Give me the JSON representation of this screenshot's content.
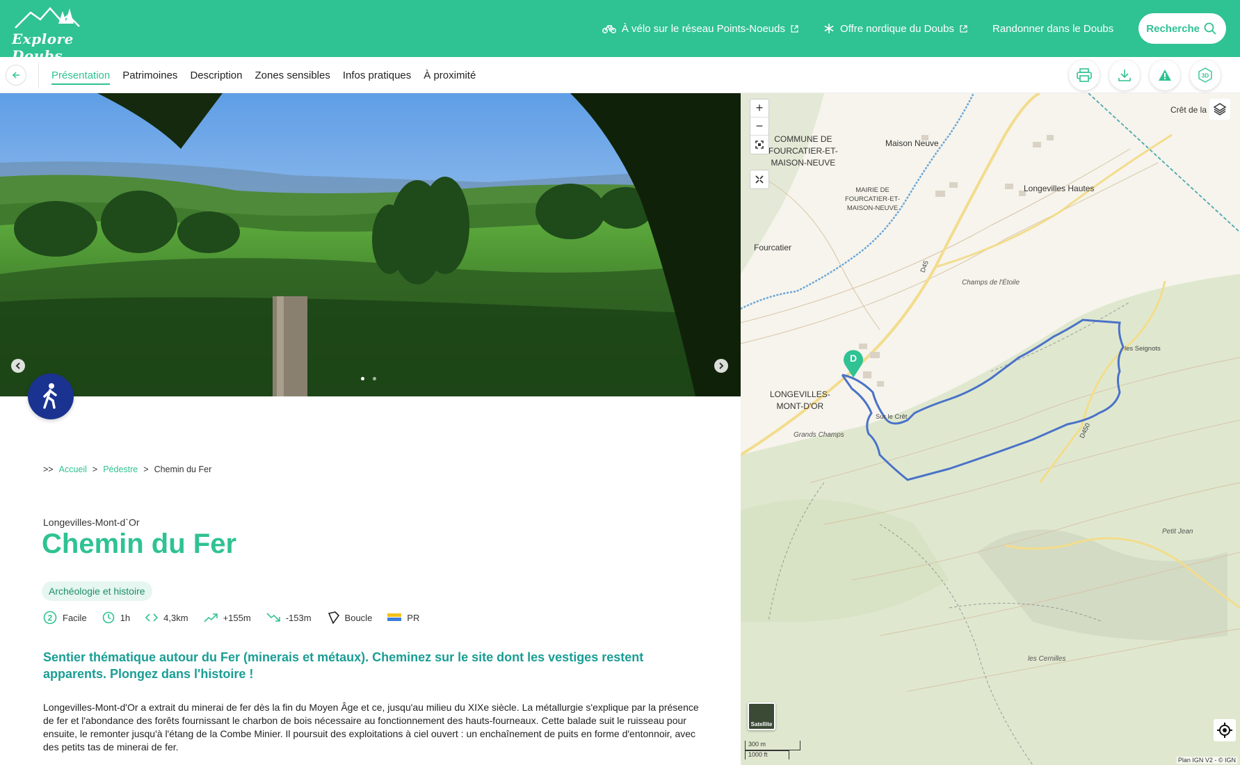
{
  "header": {
    "logo_text": "Explore Doubs",
    "links": [
      {
        "label": "À vélo sur le réseau Points-Noeuds",
        "icon": "bicycle-icon",
        "external": true
      },
      {
        "label": "Offre nordique du Doubs",
        "icon": "snowflake-icon",
        "external": true
      },
      {
        "label": "Randonner dans le Doubs",
        "icon": "",
        "external": false
      }
    ],
    "search_label": "Recherche",
    "bg_color": "#2fc293"
  },
  "subnav": {
    "tabs": [
      "Présentation",
      "Patrimoines",
      "Description",
      "Zones sensibles",
      "Infos pratiques",
      "À proximité"
    ],
    "active_tab": "Présentation",
    "tools": [
      "print-icon",
      "download-icon",
      "warning-icon",
      "3d-icon"
    ]
  },
  "carousel": {
    "slide_count": 2,
    "active_slide": 1
  },
  "breadcrumb": {
    "prefix": ">>",
    "items": [
      "Accueil",
      "Pédestre",
      "Chemin du Fer"
    ]
  },
  "trek": {
    "city": "Longevilles-Mont-d`Or",
    "title": "Chemin du Fer",
    "theme": "Archéologie et histoire",
    "difficulty_level": "2",
    "difficulty": "Facile",
    "duration": "1h",
    "distance": "4,3km",
    "ascent": "+155m",
    "descent": "-153m",
    "route_type": "Boucle",
    "network": "PR",
    "lead": "Sentier thématique autour du Fer (minerais et métaux). Cheminez sur le site dont les vestiges restent apparents. Plongez dans l'histoire !",
    "body": "Longevilles-Mont-d'Or a extrait du minerai de fer dès la fin du Moyen Âge et ce, jusqu'au milieu du XIXe siècle. La métallurgie s'explique par la présence de fer et l'abondance des forêts fournissant le charbon de bois nécessaire au fonctionnement des hauts-fourneaux. Cette balade suit le ruisseau pour ensuite, le remonter jusqu'à l'étang de la Combe Minier. Il poursuit des exploitations à ciel ouvert : un enchaînement de puits en forme d'entonnoir, avec des petits tas de minerai de fer."
  },
  "map": {
    "labels": {
      "commune": "COMMUNE DE\nFOURCATIER-ET-\nMAISON-NEUVE",
      "mairie": "MAIRIE DE\nFOURCATIER-ET-\nMAISON-NEUVE",
      "maison_neuve": "Maison Neuve",
      "longevilles_hautes": "Longevilles Hautes",
      "fourcatier": "Fourcatier",
      "champs_etoile": "Champs de l'Étoile",
      "les_seignots": "les Seignots",
      "longevilles": "LONGEVILLES-\nMONT-D'OR",
      "sur_le_cret": "Sur le Crêt",
      "grands_champs": "Grands Champs",
      "petit_jean": "Petit Jean",
      "les_cernilles": "les Cernilles",
      "cret": "Crêt de la",
      "road_d45": "D45",
      "road_d450": "D450"
    },
    "start_marker": "D",
    "satellite_label": "Satellite",
    "scale_m": "300 m",
    "scale_ft": "1000 ft",
    "attribution": "Plan IGN V2 - © IGN",
    "route_color": "#4a72c8"
  }
}
